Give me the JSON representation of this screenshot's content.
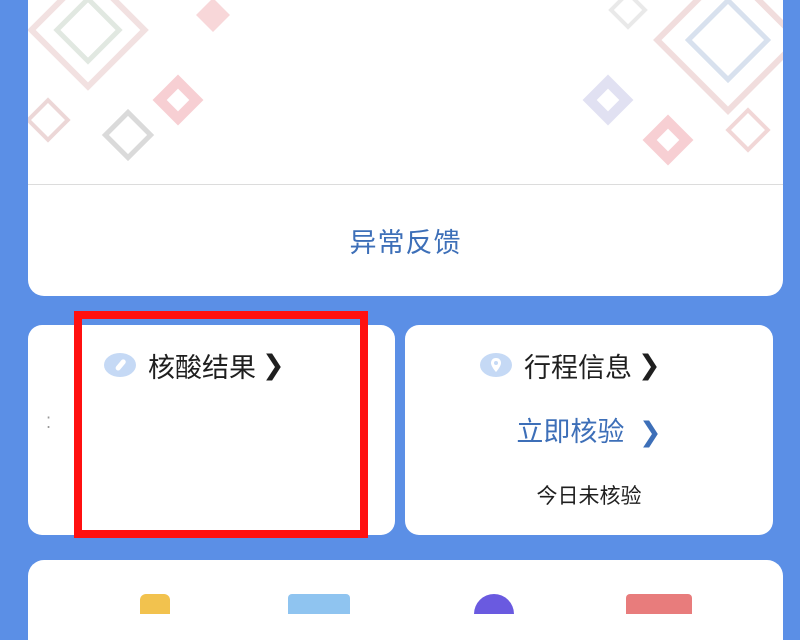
{
  "top_card": {
    "feedback_label": "异常反馈"
  },
  "nucleic_card": {
    "title": "核酸结果",
    "chevron": "❯"
  },
  "travel_card": {
    "title": "行程信息",
    "chevron": "❯",
    "verify_label": "立即核验",
    "status": "今日未核验"
  },
  "colors": {
    "background": "#5b8fe6",
    "accent": "#3d6fb8",
    "highlight": "#ff1010"
  },
  "icons": {
    "nucleic_icon": "test-tube-icon",
    "travel_icon": "location-pin-icon"
  }
}
